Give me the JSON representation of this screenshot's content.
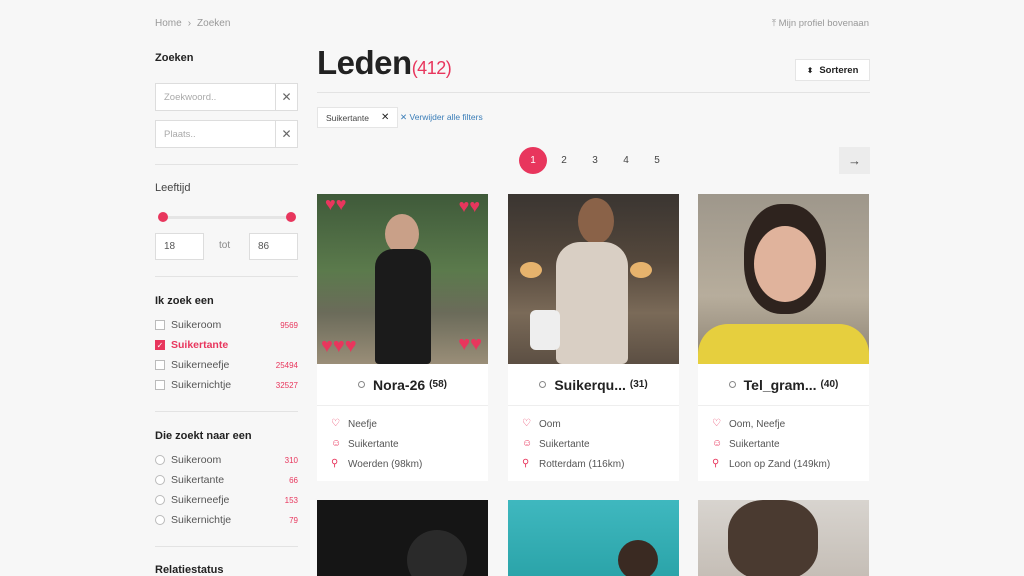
{
  "breadcrumb": {
    "home": "Home",
    "sep": "›",
    "current": "Zoeken"
  },
  "top_link": "⤒ Mijn profiel bovenaan",
  "sidebar": {
    "search_title": "Zoeken",
    "keyword_placeholder": "Zoekwoord..",
    "place_placeholder": "Plaats..",
    "age_title": "Leeftijd",
    "age_min": "18",
    "age_to": "tot",
    "age_max": "86",
    "looking_title": "Ik zoek een",
    "looking": [
      {
        "label": "Suikeroom",
        "count": "9569"
      },
      {
        "label": "Suikertante",
        "count": ""
      },
      {
        "label": "Suikerneefje",
        "count": "25494"
      },
      {
        "label": "Suikernichtje",
        "count": "32527"
      }
    ],
    "seeking_title": "Die zoekt naar een",
    "seeking": [
      {
        "label": "Suikeroom",
        "count": "310"
      },
      {
        "label": "Suikertante",
        "count": "66"
      },
      {
        "label": "Suikerneefje",
        "count": "153"
      },
      {
        "label": "Suikernichtje",
        "count": "79"
      }
    ],
    "relation_title": "Relatiestatus"
  },
  "main": {
    "title": "Leden",
    "count": "(412)",
    "sort_label": "Sorteren",
    "filter_chip": "Suikertante",
    "clear_filters": "Verwijder alle filters",
    "pages": [
      "1",
      "2",
      "3",
      "4",
      "5"
    ],
    "next": "→"
  },
  "cards": [
    {
      "name": "Nora-26",
      "age": "(58)",
      "looking": "Neefje",
      "type": "Suikertante",
      "location": "Woerden (98km)"
    },
    {
      "name": "Suikerqu...",
      "age": "(31)",
      "looking": "Oom",
      "type": "Suikertante",
      "location": "Rotterdam (116km)"
    },
    {
      "name": "Tel_gram...",
      "age": "(40)",
      "looking": "Oom, Neefje",
      "type": "Suikertante",
      "location": "Loon op Zand (149km)"
    }
  ],
  "colors": {
    "accent": "#e8365d",
    "link": "#3a7db8",
    "background": "#f7f7f7"
  }
}
